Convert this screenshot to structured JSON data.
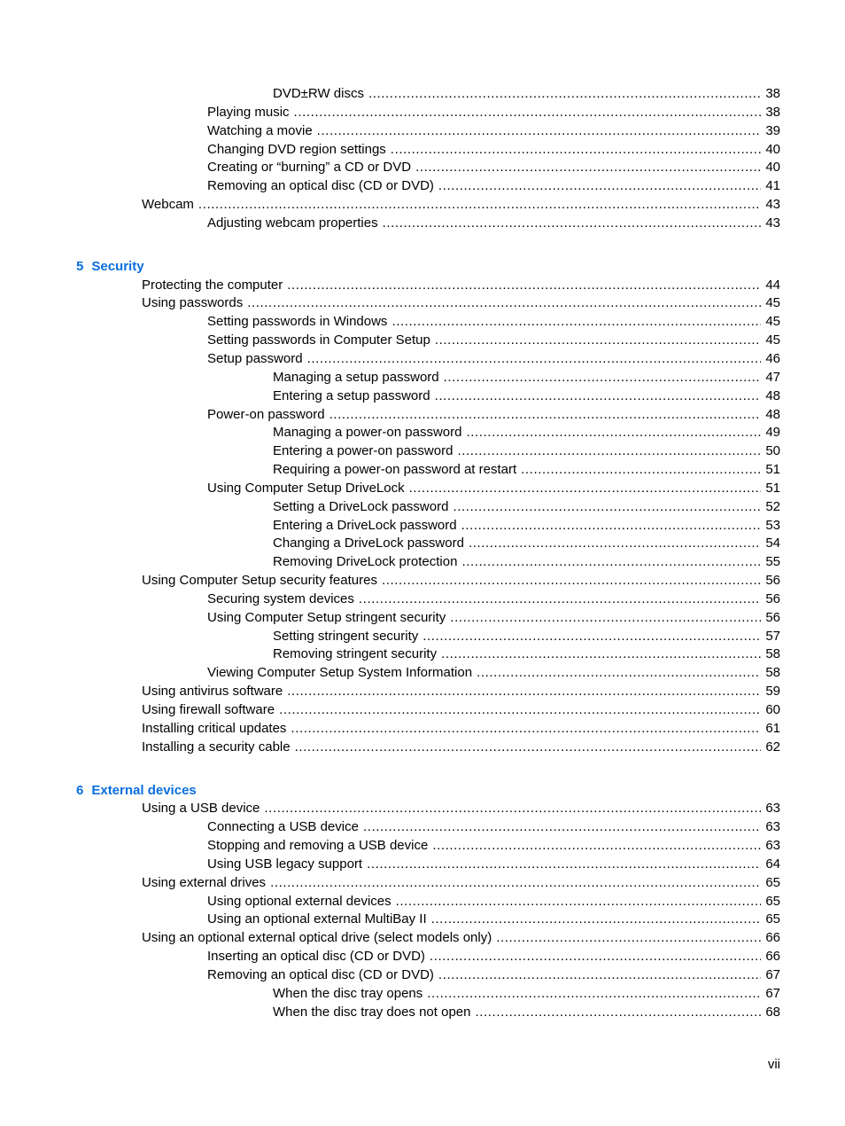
{
  "document": {
    "folio": "vii",
    "accent_color": "#0a6fe0",
    "sections": [
      {
        "chapter": null,
        "entries": [
          {
            "level": 3,
            "title": "DVD±RW discs",
            "page": "38"
          },
          {
            "level": 2,
            "title": "Playing music",
            "page": "38"
          },
          {
            "level": 2,
            "title": "Watching a movie",
            "page": "39"
          },
          {
            "level": 2,
            "title": "Changing DVD region settings",
            "page": "40"
          },
          {
            "level": 2,
            "title": "Creating or “burning” a CD or DVD",
            "page": "40"
          },
          {
            "level": 2,
            "title": "Removing an optical disc (CD or DVD)",
            "page": "41"
          },
          {
            "level": 1,
            "title": "Webcam",
            "page": "43"
          },
          {
            "level": 2,
            "title": "Adjusting webcam properties",
            "page": "43"
          }
        ]
      },
      {
        "chapter": {
          "number": "5",
          "title": "Security"
        },
        "entries": [
          {
            "level": 1,
            "title": "Protecting the computer",
            "page": "44"
          },
          {
            "level": 1,
            "title": "Using passwords",
            "page": "45"
          },
          {
            "level": 2,
            "title": "Setting passwords in Windows",
            "page": "45"
          },
          {
            "level": 2,
            "title": "Setting passwords in Computer Setup",
            "page": "45"
          },
          {
            "level": 2,
            "title": "Setup password",
            "page": "46"
          },
          {
            "level": 3,
            "title": "Managing a setup password",
            "page": "47"
          },
          {
            "level": 3,
            "title": "Entering a setup password",
            "page": "48"
          },
          {
            "level": 2,
            "title": "Power-on password",
            "page": "48"
          },
          {
            "level": 3,
            "title": "Managing a power-on password",
            "page": "49"
          },
          {
            "level": 3,
            "title": "Entering a power-on password",
            "page": "50"
          },
          {
            "level": 3,
            "title": "Requiring a power-on password at restart",
            "page": "51"
          },
          {
            "level": 2,
            "title": "Using Computer Setup DriveLock",
            "page": "51"
          },
          {
            "level": 3,
            "title": "Setting a DriveLock password",
            "page": "52"
          },
          {
            "level": 3,
            "title": "Entering a DriveLock password",
            "page": "53"
          },
          {
            "level": 3,
            "title": "Changing a DriveLock password",
            "page": "54"
          },
          {
            "level": 3,
            "title": "Removing DriveLock protection",
            "page": "55"
          },
          {
            "level": 1,
            "title": "Using Computer Setup security features",
            "page": "56"
          },
          {
            "level": 2,
            "title": "Securing system devices",
            "page": "56"
          },
          {
            "level": 2,
            "title": "Using Computer Setup stringent security",
            "page": "56"
          },
          {
            "level": 3,
            "title": "Setting stringent security",
            "page": "57"
          },
          {
            "level": 3,
            "title": "Removing stringent security",
            "page": "58"
          },
          {
            "level": 2,
            "title": "Viewing Computer Setup System Information",
            "page": "58"
          },
          {
            "level": 1,
            "title": "Using antivirus software",
            "page": "59"
          },
          {
            "level": 1,
            "title": "Using firewall software",
            "page": "60"
          },
          {
            "level": 1,
            "title": "Installing critical updates",
            "page": "61"
          },
          {
            "level": 1,
            "title": "Installing a security cable",
            "page": "62"
          }
        ]
      },
      {
        "chapter": {
          "number": "6",
          "title": "External devices"
        },
        "entries": [
          {
            "level": 1,
            "title": "Using a USB device",
            "page": "63"
          },
          {
            "level": 2,
            "title": "Connecting a USB device",
            "page": "63"
          },
          {
            "level": 2,
            "title": "Stopping and removing a USB device",
            "page": "63"
          },
          {
            "level": 2,
            "title": "Using USB legacy support",
            "page": "64"
          },
          {
            "level": 1,
            "title": "Using external drives",
            "page": "65"
          },
          {
            "level": 2,
            "title": "Using optional external devices",
            "page": "65"
          },
          {
            "level": 2,
            "title": "Using an optional external MultiBay II",
            "page": "65"
          },
          {
            "level": 1,
            "title": "Using an optional external optical drive (select models only)",
            "page": "66"
          },
          {
            "level": 2,
            "title": "Inserting an optical disc (CD or DVD)",
            "page": "66"
          },
          {
            "level": 2,
            "title": "Removing an optical disc (CD or DVD)",
            "page": "67"
          },
          {
            "level": 3,
            "title": "When the disc tray opens",
            "page": "67"
          },
          {
            "level": 3,
            "title": "When the disc tray does not open",
            "page": "68"
          }
        ]
      }
    ]
  }
}
